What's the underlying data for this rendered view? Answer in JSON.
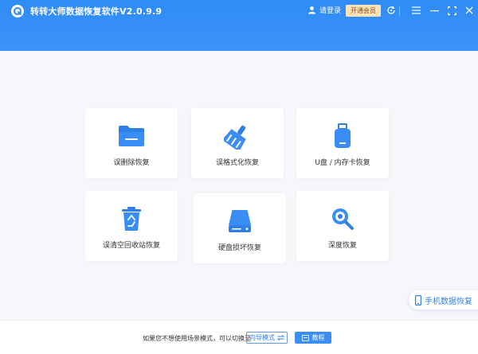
{
  "app": {
    "title": "转转大师数据恢复软件V2.0.9.9"
  },
  "titlebar": {
    "login_label": "请登录",
    "vip_label": "开通会员",
    "icons": [
      "user-icon",
      "update-icon",
      "menu-icon",
      "minimize-icon",
      "maximize-icon",
      "close-icon"
    ]
  },
  "colors": {
    "header": "#2f8cf6",
    "accent": "#2f7fe6",
    "vip_bg": "#fde3b8",
    "background": "#f5f7fb"
  },
  "cards": [
    {
      "label": "误删除恢复",
      "icon": "folder-icon"
    },
    {
      "label": "误格式化恢复",
      "icon": "broom-icon"
    },
    {
      "label": "U盘 / 内存卡恢复",
      "icon": "usb-drive-icon"
    },
    {
      "label": "误清空回收站恢复",
      "icon": "recycle-bin-icon"
    },
    {
      "label": "硬盘损坏恢复",
      "icon": "hard-disk-icon"
    },
    {
      "label": "深度恢复",
      "icon": "deep-scan-icon"
    }
  ],
  "phone_recovery": {
    "label": "手机数据恢复"
  },
  "footer": {
    "hint": "如果您不想使用场景模式，可以切换至",
    "guide_label": "向导模式",
    "tutorial_label": "教程"
  }
}
